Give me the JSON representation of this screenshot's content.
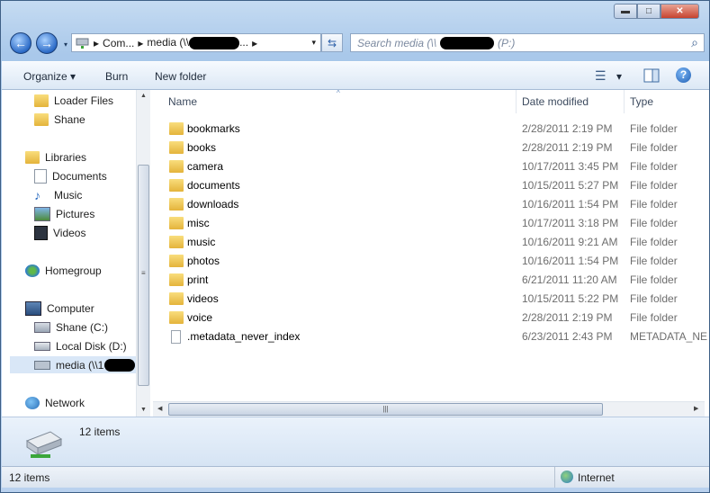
{
  "window": {
    "minimize": "▬",
    "maximize": "□",
    "close": "✕"
  },
  "nav_buttons": {
    "back_icon": "←",
    "forward_icon": "→",
    "dropdown_icon": "▾"
  },
  "address": {
    "arrow": "▸",
    "seg1": "Com...",
    "seg2": "media (\\\\",
    "seg2_tail": "...",
    "dropdown": "▾"
  },
  "search": {
    "placeholder_prefix": "Search media (\\\\",
    "placeholder_suffix": "(P:)",
    "icon": "⌕"
  },
  "toolbar": {
    "organize": "Organize",
    "burn": "Burn",
    "new_folder": "New folder",
    "view_icon": "☰",
    "dropdown": "▾",
    "help": "?"
  },
  "nav_pane": {
    "favorites": [
      {
        "label": "Loader Files"
      },
      {
        "label": "Shane"
      }
    ],
    "libraries": {
      "label": "Libraries",
      "items": [
        {
          "label": "Documents"
        },
        {
          "label": "Music"
        },
        {
          "label": "Pictures"
        },
        {
          "label": "Videos"
        }
      ]
    },
    "homegroup": "Homegroup",
    "computer": {
      "label": "Computer",
      "items": [
        {
          "label": "Shane (C:)"
        },
        {
          "label": "Local Disk (D:)"
        },
        {
          "label": "media (\\\\1"
        }
      ]
    },
    "network": "Network"
  },
  "columns": {
    "name": "Name",
    "date": "Date modified",
    "type": "Type"
  },
  "files": [
    {
      "name": "bookmarks",
      "date": "2/28/2011 2:19 PM",
      "type": "File folder"
    },
    {
      "name": "books",
      "date": "2/28/2011 2:19 PM",
      "type": "File folder"
    },
    {
      "name": "camera",
      "date": "10/17/2011 3:45 PM",
      "type": "File folder"
    },
    {
      "name": "documents",
      "date": "10/15/2011 5:27 PM",
      "type": "File folder"
    },
    {
      "name": "downloads",
      "date": "10/16/2011 1:54 PM",
      "type": "File folder"
    },
    {
      "name": "misc",
      "date": "10/17/2011 3:18 PM",
      "type": "File folder"
    },
    {
      "name": "music",
      "date": "10/16/2011 9:21 AM",
      "type": "File folder"
    },
    {
      "name": "photos",
      "date": "10/16/2011 1:54 PM",
      "type": "File folder"
    },
    {
      "name": "print",
      "date": "6/21/2011 11:20 AM",
      "type": "File folder"
    },
    {
      "name": "videos",
      "date": "10/15/2011 5:22 PM",
      "type": "File folder"
    },
    {
      "name": "voice",
      "date": "2/28/2011 2:19 PM",
      "type": "File folder"
    },
    {
      "name": ".metadata_never_index",
      "date": "6/23/2011 2:43 PM",
      "type": "METADATA_NE"
    }
  ],
  "details": {
    "count": "12 items"
  },
  "status": {
    "count": "12 items",
    "zone": "Internet"
  }
}
